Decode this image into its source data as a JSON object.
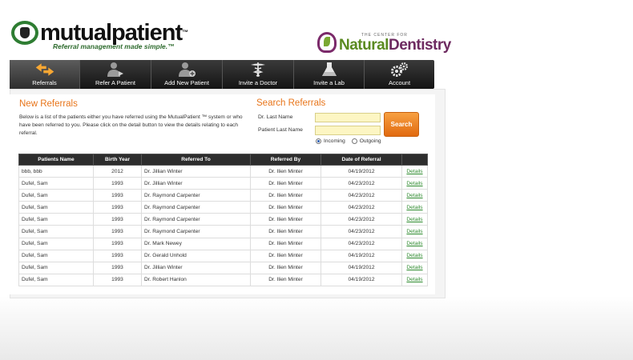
{
  "header": {
    "logo_text": "mutualpatient",
    "logo_tm": "™",
    "logo_tagline": "Referral management made simple.™",
    "partner_small": "THE CENTER FOR",
    "partner_name_1": "Natural",
    "partner_name_2": "Dentistry"
  },
  "nav": {
    "items": [
      {
        "label": "Referrals",
        "icon": "arrows-icon",
        "active": true
      },
      {
        "label": "Refer A Patient",
        "icon": "refer-patient-icon"
      },
      {
        "label": "Add New Patient",
        "icon": "add-patient-icon"
      },
      {
        "label": "Invite a Doctor",
        "icon": "caduceus-icon"
      },
      {
        "label": "Invite a Lab",
        "icon": "flask-icon"
      },
      {
        "label": "Account",
        "icon": "gears-icon"
      }
    ]
  },
  "new_referrals": {
    "title": "New Referrals",
    "description": "Below is a list of the patients either you have referred using the MutualPatient ™ system or who have been referred to you. Please click on the detail button to view the details relating to each referral."
  },
  "search": {
    "title": "Search Referrals",
    "dr_last_name_label": "Dr. Last Name",
    "dr_last_name_value": "",
    "patient_last_name_label": "Patient Last Name",
    "patient_last_name_value": "",
    "button_label": "Search",
    "incoming_label": "Incoming",
    "outgoing_label": "Outgoing",
    "selected": "Incoming"
  },
  "table": {
    "headers": [
      "Patients Name",
      "Birth Year",
      "Referred To",
      "Referred By",
      "Date of Referral",
      ""
    ],
    "rows": [
      {
        "patient": "bbb, bbb",
        "birth_year": "2012",
        "referred_to": "Dr. Jillian Winter",
        "referred_by": "Dr. Ilien Minter",
        "date": "04/19/2012",
        "action": "Details"
      },
      {
        "patient": "Dufel, Sam",
        "birth_year": "1993",
        "referred_to": "Dr. Jillian Winter",
        "referred_by": "Dr. Ilien Minter",
        "date": "04/23/2012",
        "action": "Details"
      },
      {
        "patient": "Dufel, Sam",
        "birth_year": "1993",
        "referred_to": "Dr. Raymond Carpenter",
        "referred_by": "Dr. Ilien Minter",
        "date": "04/23/2012",
        "action": "Details"
      },
      {
        "patient": "Dufel, Sam",
        "birth_year": "1993",
        "referred_to": "Dr. Raymond Carpenter",
        "referred_by": "Dr. Ilien Minter",
        "date": "04/23/2012",
        "action": "Details"
      },
      {
        "patient": "Dufel, Sam",
        "birth_year": "1993",
        "referred_to": "Dr. Raymond Carpenter",
        "referred_by": "Dr. Ilien Minter",
        "date": "04/23/2012",
        "action": "Details"
      },
      {
        "patient": "Dufel, Sam",
        "birth_year": "1993",
        "referred_to": "Dr. Raymond Carpenter",
        "referred_by": "Dr. Ilien Minter",
        "date": "04/23/2012",
        "action": "Details"
      },
      {
        "patient": "Dufel, Sam",
        "birth_year": "1993",
        "referred_to": "Dr. Mark Newey",
        "referred_by": "Dr. Ilien Minter",
        "date": "04/23/2012",
        "action": "Details"
      },
      {
        "patient": "Dufel, Sam",
        "birth_year": "1993",
        "referred_to": "Dr. Gerald Unhold",
        "referred_by": "Dr. Ilien Minter",
        "date": "04/19/2012",
        "action": "Details"
      },
      {
        "patient": "Dufel, Sam",
        "birth_year": "1993",
        "referred_to": "Dr. Jillian Winter",
        "referred_by": "Dr. Ilien Minter",
        "date": "04/19/2012",
        "action": "Details"
      },
      {
        "patient": "Dufel, Sam",
        "birth_year": "1993",
        "referred_to": "Dr. Robert Hanlon",
        "referred_by": "Dr. Ilien Minter",
        "date": "04/19/2012",
        "action": "Details"
      }
    ]
  },
  "colors": {
    "accent_orange": "#e8751a",
    "link_green": "#2e8b2e",
    "nav_dark": "#1a1a1a"
  }
}
